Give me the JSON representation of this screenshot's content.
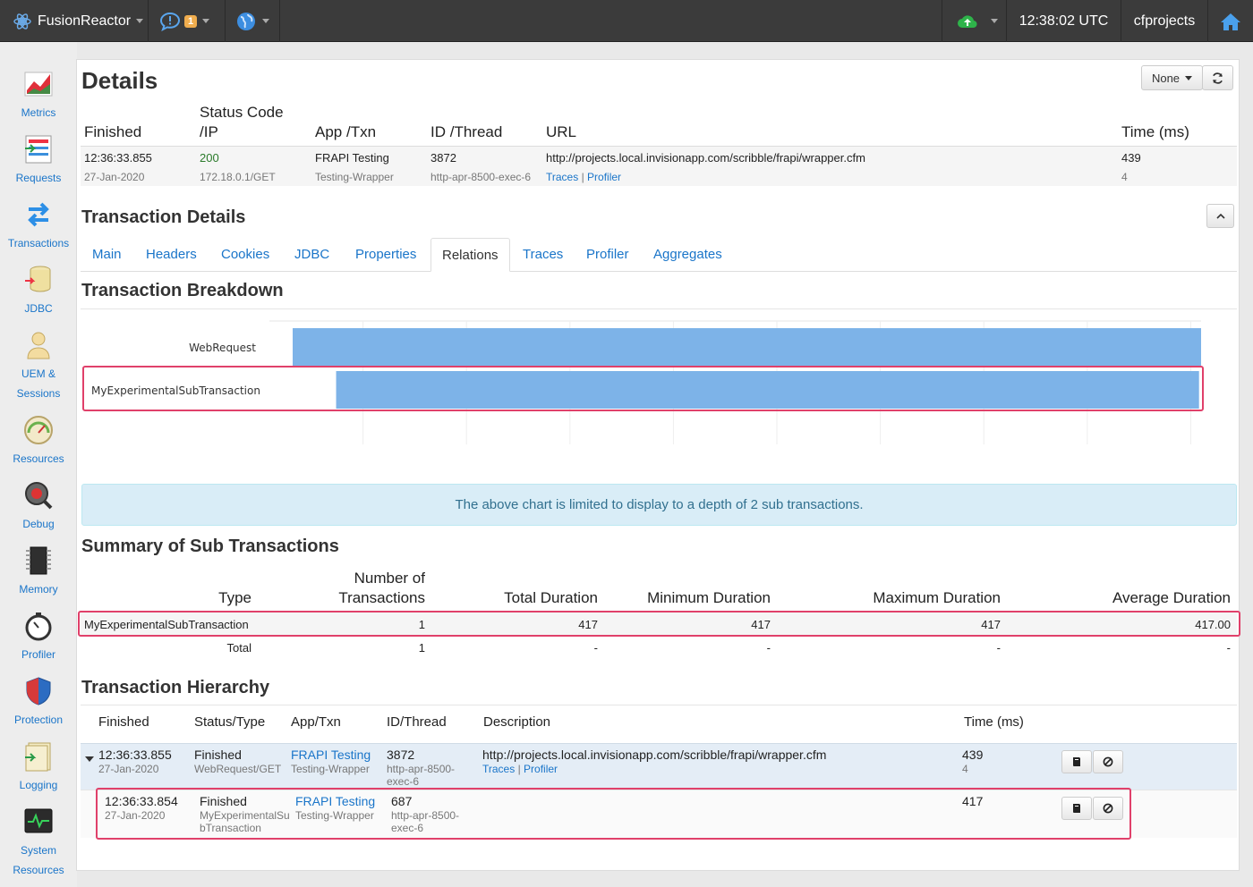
{
  "topbar": {
    "brand": "FusionReactor",
    "notification_count": "1",
    "time": "12:38:02 UTC",
    "instance": "cfprojects"
  },
  "sidebar": {
    "items": [
      {
        "label": "Metrics",
        "icon": "metrics-chart-icon"
      },
      {
        "label": "Requests",
        "icon": "requests-icon"
      },
      {
        "label": "Transactions",
        "icon": "transactions-arrows-icon"
      },
      {
        "label": "JDBC",
        "icon": "database-icon"
      },
      {
        "label": "UEM & Sessions",
        "icon": "user-icon"
      },
      {
        "label": "Resources",
        "icon": "gauge-icon"
      },
      {
        "label": "Debug",
        "icon": "debug-icon"
      },
      {
        "label": "Memory",
        "icon": "memory-chip-icon"
      },
      {
        "label": "Profiler",
        "icon": "stopwatch-icon"
      },
      {
        "label": "Protection",
        "icon": "shield-icon"
      },
      {
        "label": "Logging",
        "icon": "log-file-icon"
      },
      {
        "label": "System Resources",
        "icon": "system-monitor-icon"
      }
    ]
  },
  "details": {
    "title": "Details",
    "filter_label": "None",
    "headers": {
      "finished": "Finished",
      "status_top": "Status Code",
      "status_bottom": "/IP",
      "app": "App /Txn",
      "id": "ID /Thread",
      "url": "URL",
      "time": "Time (ms)"
    },
    "row": {
      "finished": "12:36:33.855",
      "date": "27-Jan-2020",
      "status": "200",
      "ip": "172.18.0.1/GET",
      "app": "FRAPI Testing",
      "txn": "Testing-Wrapper",
      "id": "3872",
      "thread": "http-apr-8500-exec-6",
      "url": "http://projects.local.invisionapp.com/scribble/frapi/wrapper.cfm",
      "traces": "Traces",
      "sep": "|",
      "profiler": "Profiler",
      "time": "439",
      "time_sub": "4"
    }
  },
  "transaction_details": {
    "title": "Transaction Details",
    "tabs": [
      "Main",
      "Headers",
      "Cookies",
      "JDBC",
      "Properties",
      "Relations",
      "Traces",
      "Profiler",
      "Aggregates"
    ],
    "active_tab": "Relations"
  },
  "breakdown": {
    "title": "Transaction Breakdown",
    "note": "The above chart is limited to display to a depth of 2 sub transactions."
  },
  "chart_data": {
    "type": "bar",
    "orientation": "horizontal",
    "categories": [
      "WebRequest",
      "MyExperimentalSubTransaction"
    ],
    "series": [
      {
        "start": "12:36:33.416",
        "end": "12:36:33.855"
      },
      {
        "start": "12:36:33.437",
        "end": "12:36:33.854"
      }
    ],
    "x_ticks": [
      "12:36:33.450",
      "12:36:33.500",
      "12:36:33.550",
      "12:36:33.600",
      "12:36:33.650",
      "12:36:33.700",
      "12:36:33.750",
      "12:36:33.800",
      "12:36:33.850"
    ],
    "xlim": [
      "12:36:33.416",
      "12:36:33.855"
    ],
    "grid": true,
    "bar_color": "#7db3e8"
  },
  "summary": {
    "title": "Summary of Sub Transactions",
    "headers": {
      "type": "Type",
      "count_top": "Number of",
      "count_bottom": "Transactions",
      "total": "Total Duration",
      "min": "Minimum Duration",
      "max": "Maximum Duration",
      "avg": "Average Duration"
    },
    "rows": [
      {
        "type": "MyExperimentalSubTransaction",
        "count": "1",
        "total": "417",
        "min": "417",
        "max": "417",
        "avg": "417.00"
      },
      {
        "type": "Total",
        "count": "1",
        "total": "-",
        "min": "-",
        "max": "-",
        "avg": "-"
      }
    ]
  },
  "hierarchy": {
    "title": "Transaction Hierarchy",
    "headers": {
      "finished": "Finished",
      "status": "Status/Type",
      "app": "App/Txn",
      "id": "ID/Thread",
      "desc": "Description",
      "time": "Time (ms)"
    },
    "rows": [
      {
        "finished": "12:36:33.855",
        "date": "27-Jan-2020",
        "status": "Finished",
        "type": "WebRequest/GET",
        "app": "FRAPI Testing",
        "txn": "Testing-Wrapper",
        "id": "3872",
        "thread1": "http-apr-8500-",
        "thread2": "exec-6",
        "desc": "http://projects.local.invisionapp.com/scribble/frapi/wrapper.cfm",
        "traces": "Traces",
        "sep": "|",
        "profiler": "Profiler",
        "time": "439",
        "time_sub": "4"
      },
      {
        "finished": "12:36:33.854",
        "date": "27-Jan-2020",
        "status": "Finished",
        "type1": "MyExperimentalSu",
        "type2": "bTransaction",
        "app": "FRAPI Testing",
        "txn": "Testing-Wrapper",
        "id": "687",
        "thread1": "http-apr-8500-",
        "thread2": "exec-6",
        "time": "417"
      }
    ]
  }
}
